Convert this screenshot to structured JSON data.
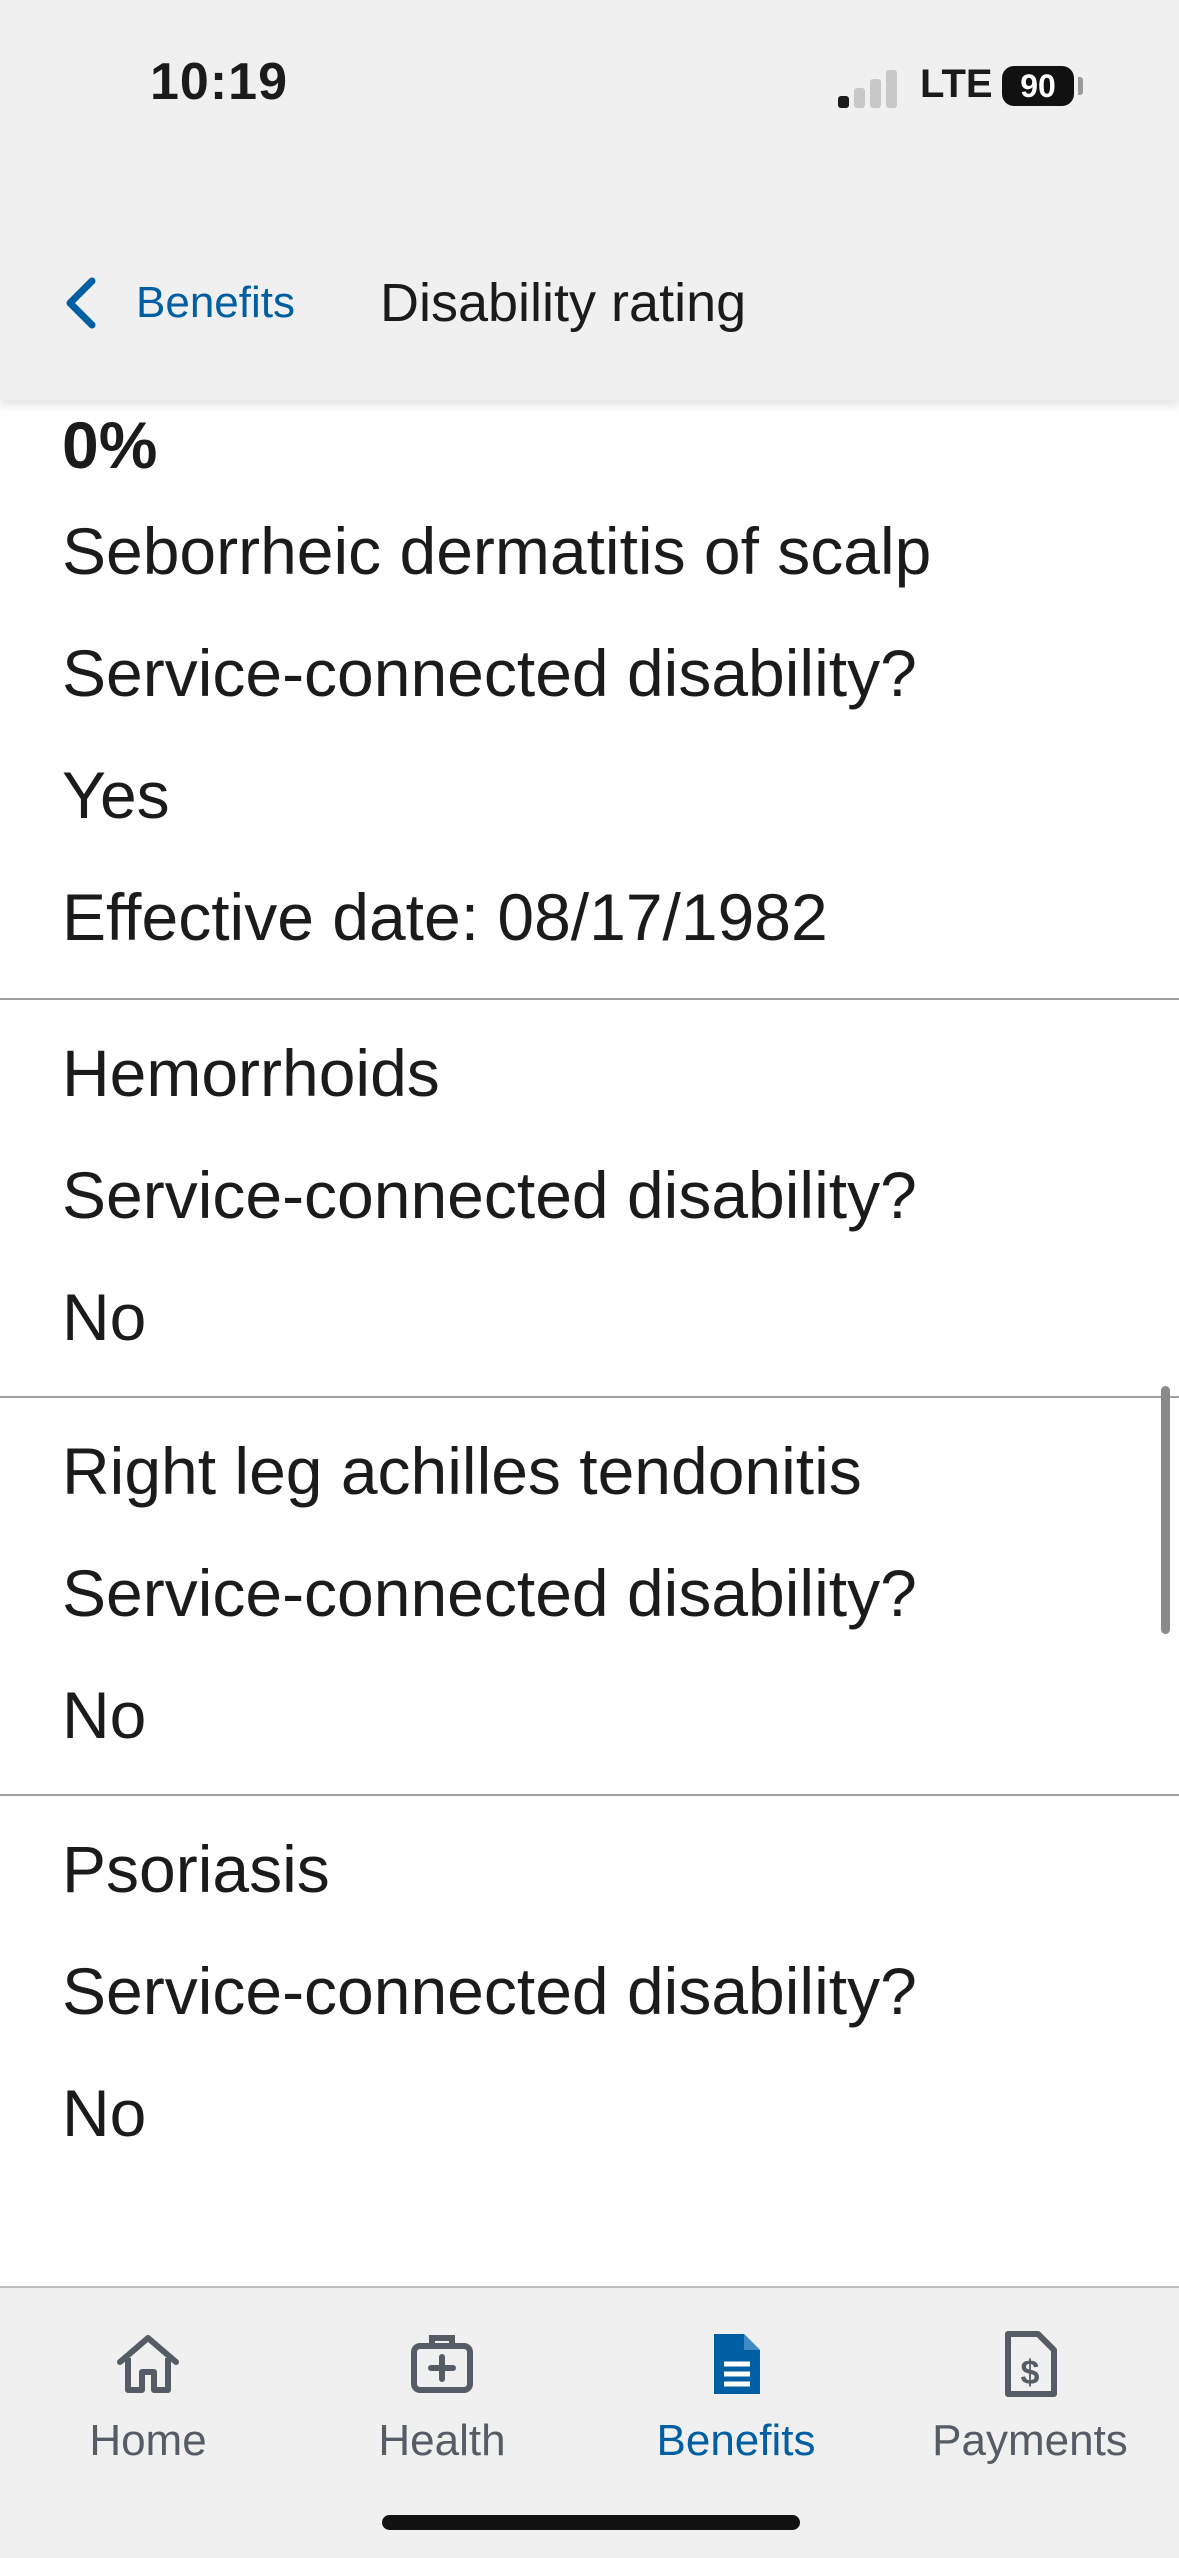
{
  "status_bar": {
    "time": "10:19",
    "network": "LTE",
    "battery": "90"
  },
  "header": {
    "back_label": "Benefits",
    "title": "Disability rating"
  },
  "ratings": [
    {
      "percent": "0%",
      "name": "Seborrheic dermatitis of scalp",
      "question": "Service-connected disability?",
      "answer": "Yes",
      "effective_date": "Effective date:  08/17/1982"
    },
    {
      "name": "Hemorrhoids",
      "question": "Service-connected disability?",
      "answer": "No"
    },
    {
      "name": "Right leg achilles tendonitis",
      "question": "Service-connected disability?",
      "answer": "No"
    },
    {
      "name": "Psoriasis",
      "question": "Service-connected disability?",
      "answer": "No"
    }
  ],
  "tabs": [
    {
      "label": "Home",
      "icon": "home-icon",
      "active": false
    },
    {
      "label": "Health",
      "icon": "medical-kit-icon",
      "active": false
    },
    {
      "label": "Benefits",
      "icon": "document-icon",
      "active": true
    },
    {
      "label": "Payments",
      "icon": "payment-document-icon",
      "active": false
    }
  ],
  "colors": {
    "accent": "#005ea2",
    "inactive": "#565c65",
    "header_bg": "#f0f0f0"
  }
}
